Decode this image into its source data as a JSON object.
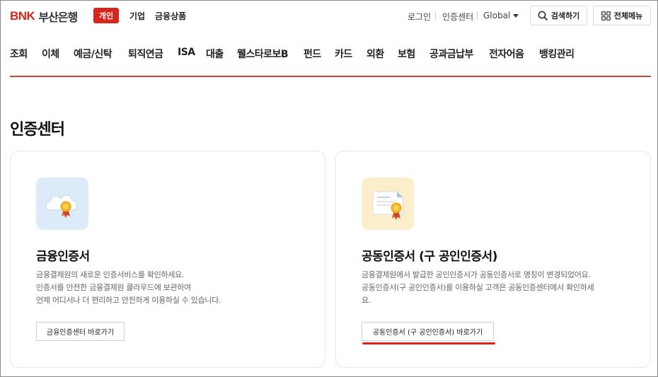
{
  "header": {
    "logo_mark": "BNK",
    "logo_name": "부산은행",
    "segment_active": "개인",
    "top_links": [
      "기업",
      "금융상품"
    ],
    "utility_links": [
      "로그인",
      "인증센터"
    ],
    "language": "Global",
    "search_label": "검색하기",
    "menu_label": "전체메뉴"
  },
  "gnb": {
    "items": [
      "조회",
      "이체",
      "예금/신탁",
      "퇴직연금",
      "ISA",
      "대출",
      "웰스타로보B",
      "펀드",
      "카드",
      "외환",
      "보험",
      "공과금납부",
      "전자어음",
      "뱅킹관리"
    ]
  },
  "page": {
    "title": "인증센터"
  },
  "cards": [
    {
      "title": "금융인증서",
      "desc": [
        "금융결제원의 새로운 인증서비스를 확인하세요.",
        "인증서를 안전한 금융결제원 클라우드에 보관하여",
        "언제 어디서나 더 편리하고 안전하게 이용하실 수 있습니다."
      ],
      "button": "금융인증센터 바로가기",
      "icon": "cloud-certificate-icon",
      "icon_bg": "#dcebfa"
    },
    {
      "title": "공동인증서 (구 공인인증서)",
      "desc": [
        "금융결제원에서 발급한 공인인증서가 공동인증서로 명칭이 변경되었어요.",
        "공동인증서(구 공인인증서)를 이용하실 고객은 공동인증센터에서 확인하세",
        "요."
      ],
      "button": "공동인증서 (구 공인인증서) 바로가기",
      "icon": "document-certificate-icon",
      "icon_bg": "#fdeecb"
    }
  ],
  "colors": {
    "brand_red": "#d7261e",
    "gnb_underline": "#c9452b"
  }
}
